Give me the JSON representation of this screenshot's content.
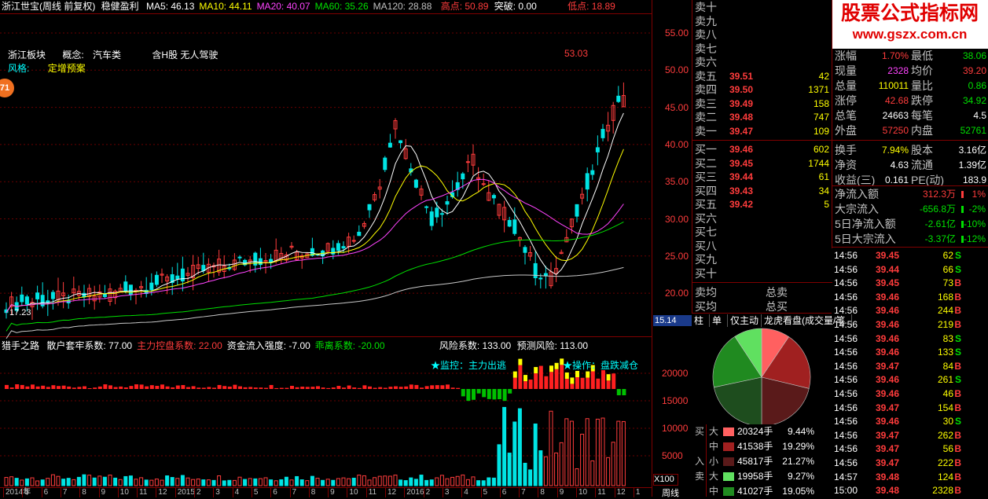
{
  "header": {
    "title": "浙江世宝(周线 前复权)",
    "style": "稳健盈利",
    "ma": [
      {
        "label": "MA5: 46.13",
        "color": "#ffffff"
      },
      {
        "label": "MA10: 44.11",
        "color": "#ffff00"
      },
      {
        "label": "MA20: 40.07",
        "color": "#ff44ff"
      },
      {
        "label": "MA60: 35.26",
        "color": "#00e000"
      },
      {
        "label": "MA120: 28.88",
        "color": "#c0c0c0"
      }
    ],
    "high": "高点: 50.89",
    "breakout": "突破: 0.00",
    "low": "低点: 18.89"
  },
  "info": {
    "sector_label": "浙江板块",
    "concept_label": "概念:",
    "concept_value": "汽车类",
    "concept_tags": "含H股 无人驾驶",
    "style_label": "风格:",
    "style_value": "定增预案",
    "badge": "71"
  },
  "price_axis": [
    "55.00",
    "50.00",
    "45.00",
    "40.00",
    "35.00",
    "30.00",
    "25.00",
    "20.00"
  ],
  "price_marks": {
    "high": "53.03",
    "low": "17.23",
    "cursor": "15.14"
  },
  "indicator": {
    "title": "猎手之路",
    "items": [
      {
        "label": "散户套牢系数: 77.00",
        "color": "#ffffff"
      },
      {
        "label": "主力控盘系数: 22.00",
        "color": "#ff3c3c"
      },
      {
        "label": "资金流入强度: -7.00",
        "color": "#ffffff"
      },
      {
        "label": "乖离系数: -20.00",
        "color": "#00e000"
      }
    ],
    "risk": "风险系数: 133.00",
    "predict": "预测风险: 113.00",
    "monitor": "★监控：主力出逃",
    "operate": "★操作：盘跌减仓"
  },
  "indicator_axis": [
    "20000",
    "15000",
    "10000",
    "5000"
  ],
  "volume_unit": "X100",
  "x_axis": [
    "2014年",
    "5",
    "6",
    "7",
    "8",
    "9",
    "10",
    "11",
    "12",
    "2015",
    "2",
    "3",
    "4",
    "5",
    "6",
    "7",
    "8",
    "9",
    "10",
    "11",
    "12",
    "2016",
    "2",
    "3",
    "4",
    "5",
    "6",
    "7",
    "8",
    "9",
    "10",
    "11",
    "12",
    "1"
  ],
  "period": "周线",
  "orderbook": {
    "sell": [
      {
        "label": "卖十",
        "price": "",
        "vol": ""
      },
      {
        "label": "卖九",
        "price": "",
        "vol": ""
      },
      {
        "label": "卖八",
        "price": "",
        "vol": ""
      },
      {
        "label": "卖七",
        "price": "",
        "vol": ""
      },
      {
        "label": "卖六",
        "price": "",
        "vol": ""
      },
      {
        "label": "卖五",
        "price": "39.51",
        "vol": "42"
      },
      {
        "label": "卖四",
        "price": "39.50",
        "vol": "1371"
      },
      {
        "label": "卖三",
        "price": "39.49",
        "vol": "158"
      },
      {
        "label": "卖二",
        "price": "39.48",
        "vol": "747"
      },
      {
        "label": "卖一",
        "price": "39.47",
        "vol": "109"
      }
    ],
    "buy": [
      {
        "label": "买一",
        "price": "39.46",
        "vol": "602"
      },
      {
        "label": "买二",
        "price": "39.45",
        "vol": "1744"
      },
      {
        "label": "买三",
        "price": "39.44",
        "vol": "61"
      },
      {
        "label": "买四",
        "price": "39.43",
        "vol": "34"
      },
      {
        "label": "买五",
        "price": "39.42",
        "vol": "5"
      },
      {
        "label": "买六",
        "price": "",
        "vol": ""
      },
      {
        "label": "买七",
        "price": "",
        "vol": ""
      },
      {
        "label": "买八",
        "price": "",
        "vol": ""
      },
      {
        "label": "买九",
        "price": "",
        "vol": ""
      },
      {
        "label": "买十",
        "price": "",
        "vol": ""
      }
    ],
    "avg_sell": "卖均",
    "avg_buy": "买均",
    "total_sell": "总卖",
    "total_buy": "总买"
  },
  "tabs": [
    "柱",
    "单",
    "仅主动",
    "龙虎看盘(成交量/笔"
  ],
  "flow": [
    {
      "side": "买",
      "size": "大",
      "color": "#ff6060",
      "vol": "20324手",
      "pct": "9.44%"
    },
    {
      "side": "",
      "size": "中",
      "color": "#a02020",
      "vol": "41538手",
      "pct": "19.29%"
    },
    {
      "side": "入",
      "size": "小",
      "color": "#5a1a1a",
      "vol": "45817手",
      "pct": "21.27%"
    },
    {
      "side": "卖",
      "size": "大",
      "color": "#60e060",
      "vol": "19958手",
      "pct": "9.27%"
    },
    {
      "side": "",
      "size": "中",
      "color": "#208a20",
      "vol": "41027手",
      "pct": "19.05%"
    }
  ],
  "pie": [
    {
      "label": "买大",
      "value": 9.44,
      "color": "#ff6060"
    },
    {
      "label": "买中",
      "value": 19.29,
      "color": "#a02020"
    },
    {
      "label": "买小",
      "value": 21.27,
      "color": "#5a1a1a"
    },
    {
      "label": "卖小",
      "value": 21.68,
      "color": "#1e4d1e"
    },
    {
      "label": "卖中",
      "value": 19.05,
      "color": "#208a20"
    },
    {
      "label": "卖大",
      "value": 9.27,
      "color": "#60e060"
    }
  ],
  "watermark": {
    "line1": "股票公式指标网",
    "line2": "www.gszx.com.cn"
  },
  "stats": [
    {
      "k1": "涨幅",
      "v1": "1.70%",
      "c1": "#ff3c3c",
      "k2": "最低",
      "v2": "38.06",
      "c2": "#00e000"
    },
    {
      "k1": "现量",
      "v1": "2328",
      "c1": "#ff44ff",
      "k2": "均价",
      "v2": "39.20",
      "c2": "#ff3c3c"
    },
    {
      "k1": "总量",
      "v1": "110011",
      "c1": "#ffff00",
      "k2": "量比",
      "v2": "0.86",
      "c2": "#00e000"
    },
    {
      "k1": "涨停",
      "v1": "42.68",
      "c1": "#ff3c3c",
      "k2": "跌停",
      "v2": "34.92",
      "c2": "#00e000"
    },
    {
      "k1": "总笔",
      "v1": "24663",
      "c1": "#ffffff",
      "k2": "每笔",
      "v2": "4.5",
      "c2": "#ffffff"
    },
    {
      "k1": "外盘",
      "v1": "57250",
      "c1": "#ff3c3c",
      "k2": "内盘",
      "v2": "52761",
      "c2": "#00e000"
    },
    {
      "k1": "换手",
      "v1": "7.94%",
      "c1": "#ffff00",
      "k2": "股本",
      "v2": "3.16亿",
      "c2": "#ffffff"
    },
    {
      "k1": "净资",
      "v1": "4.63",
      "c1": "#ffffff",
      "k2": "流通",
      "v2": "1.39亿",
      "c2": "#ffffff"
    },
    {
      "k1": "收益(三)",
      "v1": "0.161",
      "c1": "#ffffff",
      "k2": "PE(动)",
      "v2": "183.9",
      "c2": "#ffffff"
    }
  ],
  "fund_flow": [
    {
      "k": "净流入额",
      "v": "312.3万",
      "c": "#ff3c3c",
      "p": "1%"
    },
    {
      "k": "大宗流入",
      "v": "-656.8万",
      "c": "#00e000",
      "p": "-2%"
    },
    {
      "k": "5日净流入额",
      "v": "-2.61亿",
      "c": "#00e000",
      "p": "-10%"
    },
    {
      "k": "5日大宗流入",
      "v": "-3.37亿",
      "c": "#00e000",
      "p": "-12%"
    }
  ],
  "ticks": [
    {
      "t": "14:56",
      "p": "39.45",
      "v": "62",
      "d": "S"
    },
    {
      "t": "14:56",
      "p": "39.44",
      "v": "66",
      "d": "S"
    },
    {
      "t": "14:56",
      "p": "39.45",
      "v": "73",
      "d": "B"
    },
    {
      "t": "14:56",
      "p": "39.46",
      "v": "168",
      "d": "B"
    },
    {
      "t": "14:56",
      "p": "39.46",
      "v": "244",
      "d": "B"
    },
    {
      "t": "14:56",
      "p": "39.46",
      "v": "219",
      "d": "B"
    },
    {
      "t": "14:56",
      "p": "39.46",
      "v": "83",
      "d": "S"
    },
    {
      "t": "14:56",
      "p": "39.46",
      "v": "133",
      "d": "S"
    },
    {
      "t": "14:56",
      "p": "39.47",
      "v": "84",
      "d": "B"
    },
    {
      "t": "14:56",
      "p": "39.46",
      "v": "261",
      "d": "S"
    },
    {
      "t": "14:56",
      "p": "39.46",
      "v": "46",
      "d": "B"
    },
    {
      "t": "14:56",
      "p": "39.47",
      "v": "154",
      "d": "B"
    },
    {
      "t": "14:56",
      "p": "39.46",
      "v": "30",
      "d": "S"
    },
    {
      "t": "14:56",
      "p": "39.47",
      "v": "262",
      "d": "B"
    },
    {
      "t": "14:56",
      "p": "39.47",
      "v": "56",
      "d": "B"
    },
    {
      "t": "14:56",
      "p": "39.47",
      "v": "222",
      "d": "B"
    },
    {
      "t": "14:57",
      "p": "39.48",
      "v": "124",
      "d": "B"
    },
    {
      "t": "15:00",
      "p": "39.48",
      "v": "2328",
      "d": "B"
    }
  ]
}
